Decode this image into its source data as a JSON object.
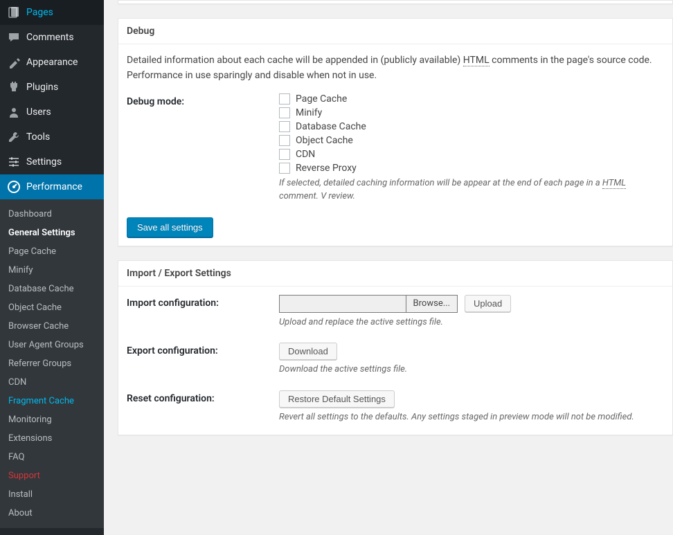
{
  "sidebar": {
    "main": [
      {
        "key": "pages",
        "label": "Pages"
      },
      {
        "key": "comments",
        "label": "Comments"
      },
      {
        "key": "appearance",
        "label": "Appearance"
      },
      {
        "key": "plugins",
        "label": "Plugins"
      },
      {
        "key": "users",
        "label": "Users"
      },
      {
        "key": "tools",
        "label": "Tools"
      },
      {
        "key": "settings",
        "label": "Settings"
      },
      {
        "key": "performance",
        "label": "Performance"
      }
    ],
    "sub": [
      {
        "label": "Dashboard"
      },
      {
        "label": "General Settings",
        "current": true
      },
      {
        "label": "Page Cache"
      },
      {
        "label": "Minify"
      },
      {
        "label": "Database Cache"
      },
      {
        "label": "Object Cache"
      },
      {
        "label": "Browser Cache"
      },
      {
        "label": "User Agent Groups"
      },
      {
        "label": "Referrer Groups"
      },
      {
        "label": "CDN"
      },
      {
        "label": "Fragment Cache",
        "fragment": true
      },
      {
        "label": "Monitoring"
      },
      {
        "label": "Extensions"
      },
      {
        "label": "FAQ"
      },
      {
        "label": "Support",
        "support": true
      },
      {
        "label": "Install"
      },
      {
        "label": "About"
      }
    ]
  },
  "debug": {
    "heading": "Debug",
    "intro_before": "Detailed information about each cache will be appended in (publicly available) ",
    "intro_u": "HTML",
    "intro_after": " comments in the page's source code. Performance in use sparingly and disable when not in use.",
    "label": "Debug mode:",
    "options": [
      "Page Cache",
      "Minify",
      "Database Cache",
      "Object Cache",
      "CDN",
      "Reverse Proxy"
    ],
    "desc_before": "If selected, detailed caching information will be appear at the end of each page in a ",
    "desc_u": "HTML",
    "desc_after": " comment. V review.",
    "save": "Save all settings"
  },
  "io": {
    "heading": "Import / Export Settings",
    "import_label": "Import configuration:",
    "browse": "Browse...",
    "upload": "Upload",
    "import_desc": "Upload and replace the active settings file.",
    "export_label": "Export configuration:",
    "download": "Download",
    "export_desc": "Download the active settings file.",
    "reset_label": "Reset configuration:",
    "restore": "Restore Default Settings",
    "reset_desc": "Revert all settings to the defaults. Any settings staged in preview mode will not be modified."
  }
}
